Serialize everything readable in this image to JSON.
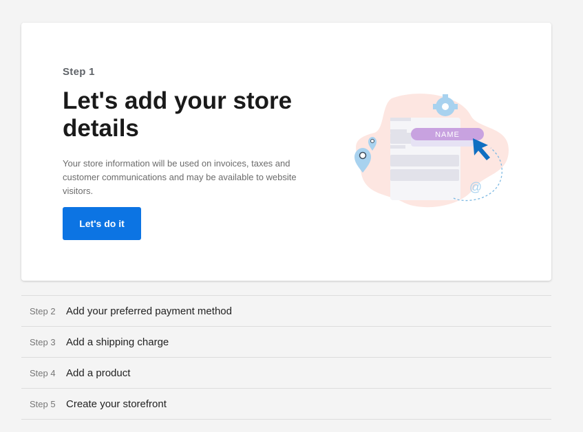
{
  "card": {
    "step_label": "Step 1",
    "title": "Let's add your store details",
    "description": "Your store information will be used on invoices, taxes and customer communications and may be available to website visitors.",
    "cta_label": "Let's do it"
  },
  "illustration": {
    "name_tag": "NAME",
    "at_symbol": "@",
    "icon": "store-details-illustration"
  },
  "steps": [
    {
      "number": "Step 2",
      "label": "Add your preferred payment method"
    },
    {
      "number": "Step 3",
      "label": "Add a shipping charge"
    },
    {
      "number": "Step 4",
      "label": "Add a product"
    },
    {
      "number": "Step 5",
      "label": "Create your storefront"
    }
  ],
  "colors": {
    "primary": "#0c74e3",
    "background": "#f4f4f4",
    "card": "#ffffff",
    "name_tag": "#c8a2e0",
    "blob": "#fde6e1"
  }
}
